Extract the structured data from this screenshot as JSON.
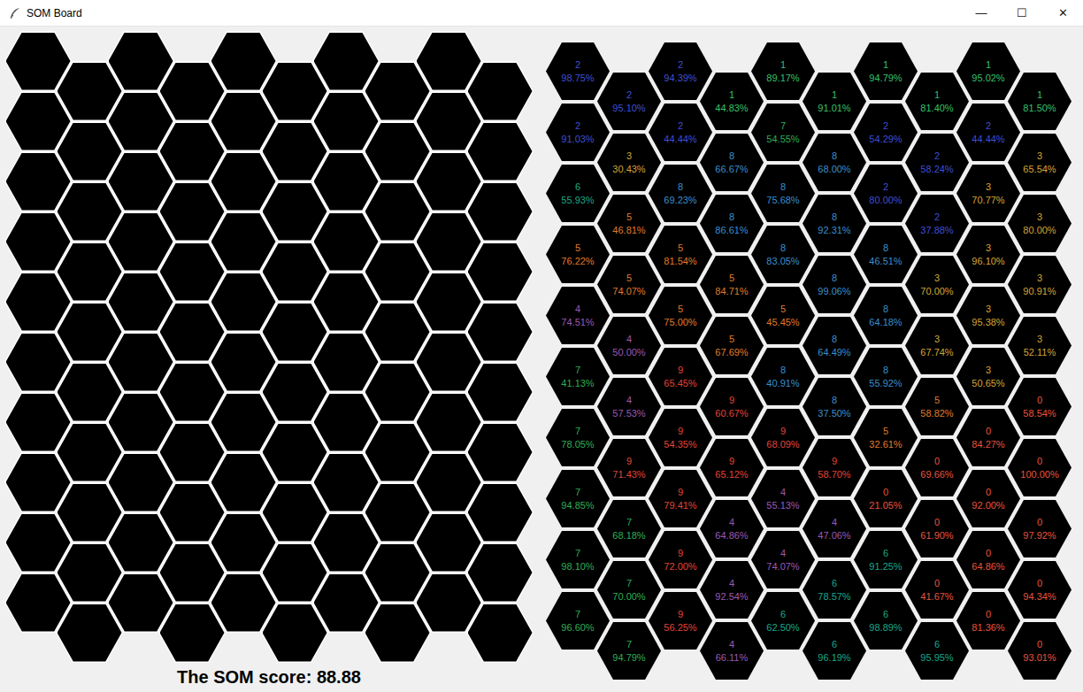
{
  "window": {
    "title": "SOM Board",
    "controls": [
      "—",
      "☐",
      "✕"
    ]
  },
  "label_map": {
    "columns": [
      [
        {
          "label": "2",
          "accuracy": "98.75%",
          "color": "#3f4fd6"
        },
        {
          "label": "2",
          "accuracy": "91.03%",
          "color": "#3f4fd6"
        },
        {
          "label": "6",
          "accuracy": "55.93%",
          "color": "#1aa88a"
        },
        {
          "label": "5",
          "accuracy": "76.22%",
          "color": "#e07b2a"
        },
        {
          "label": "4",
          "accuracy": "74.51%",
          "color": "#9b59b6"
        },
        {
          "label": "7",
          "accuracy": "41.13%",
          "color": "#2fae57"
        },
        {
          "label": "7",
          "accuracy": "78.05%",
          "color": "#2fae57"
        },
        {
          "label": "7",
          "accuracy": "94.85%",
          "color": "#2fae57"
        },
        {
          "label": "7",
          "accuracy": "98.10%",
          "color": "#2fae57"
        },
        {
          "label": "7",
          "accuracy": "96.60%",
          "color": "#2fae57"
        }
      ],
      [
        {
          "label": "2",
          "accuracy": "95.10%",
          "color": "#3f4fd6"
        },
        {
          "label": "3",
          "accuracy": "30.43%",
          "color": "#d4a537"
        },
        {
          "label": "5",
          "accuracy": "46.81%",
          "color": "#e07b2a"
        },
        {
          "label": "5",
          "accuracy": "74.07%",
          "color": "#e07b2a"
        },
        {
          "label": "4",
          "accuracy": "50.00%",
          "color": "#9b59b6"
        },
        {
          "label": "4",
          "accuracy": "57.53%",
          "color": "#9b59b6"
        },
        {
          "label": "9",
          "accuracy": "71.43%",
          "color": "#e0443a"
        },
        {
          "label": "7",
          "accuracy": "68.18%",
          "color": "#2fae57"
        },
        {
          "label": "7",
          "accuracy": "70.00%",
          "color": "#2fae57"
        },
        {
          "label": "7",
          "accuracy": "94.79%",
          "color": "#2fae57"
        }
      ],
      [
        {
          "label": "2",
          "accuracy": "94.39%",
          "color": "#3f4fd6"
        },
        {
          "label": "2",
          "accuracy": "44.44%",
          "color": "#3f4fd6"
        },
        {
          "label": "8",
          "accuracy": "69.23%",
          "color": "#3a8fd0"
        },
        {
          "label": "5",
          "accuracy": "81.54%",
          "color": "#e07b2a"
        },
        {
          "label": "5",
          "accuracy": "75.00%",
          "color": "#e07b2a"
        },
        {
          "label": "9",
          "accuracy": "65.45%",
          "color": "#e0443a"
        },
        {
          "label": "9",
          "accuracy": "54.35%",
          "color": "#e0443a"
        },
        {
          "label": "9",
          "accuracy": "79.41%",
          "color": "#e0443a"
        },
        {
          "label": "9",
          "accuracy": "72.00%",
          "color": "#e0443a"
        },
        {
          "label": "9",
          "accuracy": "56.25%",
          "color": "#e0443a"
        }
      ],
      [
        {
          "label": "1",
          "accuracy": "44.83%",
          "color": "#35c26a"
        },
        {
          "label": "8",
          "accuracy": "66.67%",
          "color": "#3a8fd0"
        },
        {
          "label": "8",
          "accuracy": "86.61%",
          "color": "#3a8fd0"
        },
        {
          "label": "5",
          "accuracy": "84.71%",
          "color": "#e07b2a"
        },
        {
          "label": "5",
          "accuracy": "67.69%",
          "color": "#e07b2a"
        },
        {
          "label": "9",
          "accuracy": "60.67%",
          "color": "#e0443a"
        },
        {
          "label": "9",
          "accuracy": "65.12%",
          "color": "#e0443a"
        },
        {
          "label": "4",
          "accuracy": "64.86%",
          "color": "#9b59b6"
        },
        {
          "label": "4",
          "accuracy": "92.54%",
          "color": "#9b59b6"
        },
        {
          "label": "4",
          "accuracy": "66.11%",
          "color": "#9b59b6"
        }
      ],
      [
        {
          "label": "1",
          "accuracy": "89.17%",
          "color": "#35c26a"
        },
        {
          "label": "7",
          "accuracy": "54.55%",
          "color": "#2fae57"
        },
        {
          "label": "8",
          "accuracy": "75.68%",
          "color": "#3a8fd0"
        },
        {
          "label": "8",
          "accuracy": "83.05%",
          "color": "#3a8fd0"
        },
        {
          "label": "5",
          "accuracy": "45.45%",
          "color": "#e07b2a"
        },
        {
          "label": "8",
          "accuracy": "40.91%",
          "color": "#3a8fd0"
        },
        {
          "label": "9",
          "accuracy": "68.09%",
          "color": "#e0443a"
        },
        {
          "label": "4",
          "accuracy": "55.13%",
          "color": "#9b59b6"
        },
        {
          "label": "4",
          "accuracy": "74.07%",
          "color": "#9b59b6"
        },
        {
          "label": "6",
          "accuracy": "62.50%",
          "color": "#1aa88a"
        }
      ],
      [
        {
          "label": "1",
          "accuracy": "91.01%",
          "color": "#35c26a"
        },
        {
          "label": "8",
          "accuracy": "68.00%",
          "color": "#3a8fd0"
        },
        {
          "label": "8",
          "accuracy": "92.31%",
          "color": "#3a8fd0"
        },
        {
          "label": "8",
          "accuracy": "99.06%",
          "color": "#3a8fd0"
        },
        {
          "label": "8",
          "accuracy": "64.49%",
          "color": "#3a8fd0"
        },
        {
          "label": "8",
          "accuracy": "37.50%",
          "color": "#3a8fd0"
        },
        {
          "label": "9",
          "accuracy": "58.70%",
          "color": "#e0443a"
        },
        {
          "label": "4",
          "accuracy": "47.06%",
          "color": "#9b59b6"
        },
        {
          "label": "6",
          "accuracy": "78.57%",
          "color": "#1aa88a"
        },
        {
          "label": "6",
          "accuracy": "96.19%",
          "color": "#1aa88a"
        }
      ],
      [
        {
          "label": "1",
          "accuracy": "94.79%",
          "color": "#35c26a"
        },
        {
          "label": "2",
          "accuracy": "54.29%",
          "color": "#3f4fd6"
        },
        {
          "label": "2",
          "accuracy": "80.00%",
          "color": "#3f4fd6"
        },
        {
          "label": "8",
          "accuracy": "46.51%",
          "color": "#3a8fd0"
        },
        {
          "label": "8",
          "accuracy": "64.18%",
          "color": "#3a8fd0"
        },
        {
          "label": "8",
          "accuracy": "55.92%",
          "color": "#3a8fd0"
        },
        {
          "label": "5",
          "accuracy": "32.61%",
          "color": "#e07b2a"
        },
        {
          "label": "0",
          "accuracy": "21.05%",
          "color": "#e8533f"
        },
        {
          "label": "6",
          "accuracy": "91.25%",
          "color": "#1aa88a"
        },
        {
          "label": "6",
          "accuracy": "98.89%",
          "color": "#1aa88a"
        }
      ],
      [
        {
          "label": "1",
          "accuracy": "81.40%",
          "color": "#35c26a"
        },
        {
          "label": "2",
          "accuracy": "58.24%",
          "color": "#3f4fd6"
        },
        {
          "label": "2",
          "accuracy": "37.88%",
          "color": "#3f4fd6"
        },
        {
          "label": "3",
          "accuracy": "70.00%",
          "color": "#d4a537"
        },
        {
          "label": "3",
          "accuracy": "67.74%",
          "color": "#d4a537"
        },
        {
          "label": "5",
          "accuracy": "58.82%",
          "color": "#e07b2a"
        },
        {
          "label": "0",
          "accuracy": "69.66%",
          "color": "#e8533f"
        },
        {
          "label": "0",
          "accuracy": "61.90%",
          "color": "#e8533f"
        },
        {
          "label": "0",
          "accuracy": "41.67%",
          "color": "#e8533f"
        },
        {
          "label": "6",
          "accuracy": "95.95%",
          "color": "#1aa88a"
        }
      ],
      [
        {
          "label": "1",
          "accuracy": "95.02%",
          "color": "#35c26a"
        },
        {
          "label": "2",
          "accuracy": "44.44%",
          "color": "#3f4fd6"
        },
        {
          "label": "3",
          "accuracy": "70.77%",
          "color": "#d4a537"
        },
        {
          "label": "3",
          "accuracy": "96.10%",
          "color": "#d4a537"
        },
        {
          "label": "3",
          "accuracy": "95.38%",
          "color": "#d4a537"
        },
        {
          "label": "3",
          "accuracy": "50.65%",
          "color": "#d4a537"
        },
        {
          "label": "0",
          "accuracy": "84.27%",
          "color": "#e8533f"
        },
        {
          "label": "0",
          "accuracy": "92.00%",
          "color": "#e8533f"
        },
        {
          "label": "0",
          "accuracy": "64.86%",
          "color": "#e8533f"
        },
        {
          "label": "0",
          "accuracy": "81.36%",
          "color": "#e8533f"
        }
      ],
      [
        {
          "label": "1",
          "accuracy": "81.50%",
          "color": "#35c26a"
        },
        {
          "label": "3",
          "accuracy": "65.54%",
          "color": "#d4a537"
        },
        {
          "label": "3",
          "accuracy": "80.00%",
          "color": "#d4a537"
        },
        {
          "label": "3",
          "accuracy": "90.91%",
          "color": "#d4a537"
        },
        {
          "label": "3",
          "accuracy": "52.11%",
          "color": "#d4a537"
        },
        {
          "label": "0",
          "accuracy": "58.54%",
          "color": "#e8533f"
        },
        {
          "label": "0",
          "accuracy": "100.00%",
          "color": "#e8533f"
        },
        {
          "label": "0",
          "accuracy": "97.92%",
          "color": "#e8533f"
        },
        {
          "label": "0",
          "accuracy": "94.34%",
          "color": "#e8533f"
        },
        {
          "label": "0",
          "accuracy": "93.01%",
          "color": "#e8533f"
        }
      ]
    ]
  },
  "score": {
    "text": "The SOM score: 88.88"
  }
}
